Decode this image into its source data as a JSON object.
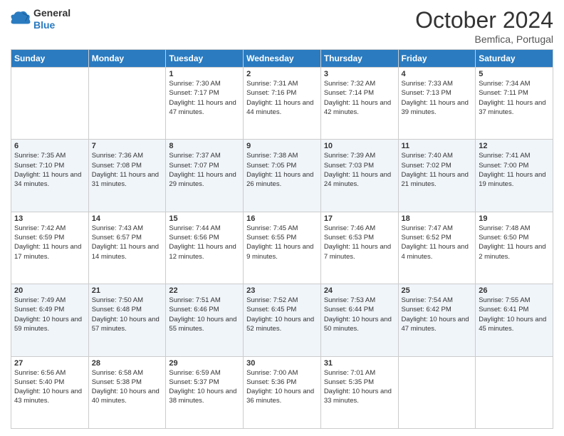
{
  "header": {
    "logo_line1": "General",
    "logo_line2": "Blue",
    "month": "October 2024",
    "location": "Bemfica, Portugal"
  },
  "weekdays": [
    "Sunday",
    "Monday",
    "Tuesday",
    "Wednesday",
    "Thursday",
    "Friday",
    "Saturday"
  ],
  "weeks": [
    [
      {
        "day": "",
        "sunrise": "",
        "sunset": "",
        "daylight": ""
      },
      {
        "day": "",
        "sunrise": "",
        "sunset": "",
        "daylight": ""
      },
      {
        "day": "1",
        "sunrise": "Sunrise: 7:30 AM",
        "sunset": "Sunset: 7:17 PM",
        "daylight": "Daylight: 11 hours and 47 minutes."
      },
      {
        "day": "2",
        "sunrise": "Sunrise: 7:31 AM",
        "sunset": "Sunset: 7:16 PM",
        "daylight": "Daylight: 11 hours and 44 minutes."
      },
      {
        "day": "3",
        "sunrise": "Sunrise: 7:32 AM",
        "sunset": "Sunset: 7:14 PM",
        "daylight": "Daylight: 11 hours and 42 minutes."
      },
      {
        "day": "4",
        "sunrise": "Sunrise: 7:33 AM",
        "sunset": "Sunset: 7:13 PM",
        "daylight": "Daylight: 11 hours and 39 minutes."
      },
      {
        "day": "5",
        "sunrise": "Sunrise: 7:34 AM",
        "sunset": "Sunset: 7:11 PM",
        "daylight": "Daylight: 11 hours and 37 minutes."
      }
    ],
    [
      {
        "day": "6",
        "sunrise": "Sunrise: 7:35 AM",
        "sunset": "Sunset: 7:10 PM",
        "daylight": "Daylight: 11 hours and 34 minutes."
      },
      {
        "day": "7",
        "sunrise": "Sunrise: 7:36 AM",
        "sunset": "Sunset: 7:08 PM",
        "daylight": "Daylight: 11 hours and 31 minutes."
      },
      {
        "day": "8",
        "sunrise": "Sunrise: 7:37 AM",
        "sunset": "Sunset: 7:07 PM",
        "daylight": "Daylight: 11 hours and 29 minutes."
      },
      {
        "day": "9",
        "sunrise": "Sunrise: 7:38 AM",
        "sunset": "Sunset: 7:05 PM",
        "daylight": "Daylight: 11 hours and 26 minutes."
      },
      {
        "day": "10",
        "sunrise": "Sunrise: 7:39 AM",
        "sunset": "Sunset: 7:03 PM",
        "daylight": "Daylight: 11 hours and 24 minutes."
      },
      {
        "day": "11",
        "sunrise": "Sunrise: 7:40 AM",
        "sunset": "Sunset: 7:02 PM",
        "daylight": "Daylight: 11 hours and 21 minutes."
      },
      {
        "day": "12",
        "sunrise": "Sunrise: 7:41 AM",
        "sunset": "Sunset: 7:00 PM",
        "daylight": "Daylight: 11 hours and 19 minutes."
      }
    ],
    [
      {
        "day": "13",
        "sunrise": "Sunrise: 7:42 AM",
        "sunset": "Sunset: 6:59 PM",
        "daylight": "Daylight: 11 hours and 17 minutes."
      },
      {
        "day": "14",
        "sunrise": "Sunrise: 7:43 AM",
        "sunset": "Sunset: 6:57 PM",
        "daylight": "Daylight: 11 hours and 14 minutes."
      },
      {
        "day": "15",
        "sunrise": "Sunrise: 7:44 AM",
        "sunset": "Sunset: 6:56 PM",
        "daylight": "Daylight: 11 hours and 12 minutes."
      },
      {
        "day": "16",
        "sunrise": "Sunrise: 7:45 AM",
        "sunset": "Sunset: 6:55 PM",
        "daylight": "Daylight: 11 hours and 9 minutes."
      },
      {
        "day": "17",
        "sunrise": "Sunrise: 7:46 AM",
        "sunset": "Sunset: 6:53 PM",
        "daylight": "Daylight: 11 hours and 7 minutes."
      },
      {
        "day": "18",
        "sunrise": "Sunrise: 7:47 AM",
        "sunset": "Sunset: 6:52 PM",
        "daylight": "Daylight: 11 hours and 4 minutes."
      },
      {
        "day": "19",
        "sunrise": "Sunrise: 7:48 AM",
        "sunset": "Sunset: 6:50 PM",
        "daylight": "Daylight: 11 hours and 2 minutes."
      }
    ],
    [
      {
        "day": "20",
        "sunrise": "Sunrise: 7:49 AM",
        "sunset": "Sunset: 6:49 PM",
        "daylight": "Daylight: 10 hours and 59 minutes."
      },
      {
        "day": "21",
        "sunrise": "Sunrise: 7:50 AM",
        "sunset": "Sunset: 6:48 PM",
        "daylight": "Daylight: 10 hours and 57 minutes."
      },
      {
        "day": "22",
        "sunrise": "Sunrise: 7:51 AM",
        "sunset": "Sunset: 6:46 PM",
        "daylight": "Daylight: 10 hours and 55 minutes."
      },
      {
        "day": "23",
        "sunrise": "Sunrise: 7:52 AM",
        "sunset": "Sunset: 6:45 PM",
        "daylight": "Daylight: 10 hours and 52 minutes."
      },
      {
        "day": "24",
        "sunrise": "Sunrise: 7:53 AM",
        "sunset": "Sunset: 6:44 PM",
        "daylight": "Daylight: 10 hours and 50 minutes."
      },
      {
        "day": "25",
        "sunrise": "Sunrise: 7:54 AM",
        "sunset": "Sunset: 6:42 PM",
        "daylight": "Daylight: 10 hours and 47 minutes."
      },
      {
        "day": "26",
        "sunrise": "Sunrise: 7:55 AM",
        "sunset": "Sunset: 6:41 PM",
        "daylight": "Daylight: 10 hours and 45 minutes."
      }
    ],
    [
      {
        "day": "27",
        "sunrise": "Sunrise: 6:56 AM",
        "sunset": "Sunset: 5:40 PM",
        "daylight": "Daylight: 10 hours and 43 minutes."
      },
      {
        "day": "28",
        "sunrise": "Sunrise: 6:58 AM",
        "sunset": "Sunset: 5:38 PM",
        "daylight": "Daylight: 10 hours and 40 minutes."
      },
      {
        "day": "29",
        "sunrise": "Sunrise: 6:59 AM",
        "sunset": "Sunset: 5:37 PM",
        "daylight": "Daylight: 10 hours and 38 minutes."
      },
      {
        "day": "30",
        "sunrise": "Sunrise: 7:00 AM",
        "sunset": "Sunset: 5:36 PM",
        "daylight": "Daylight: 10 hours and 36 minutes."
      },
      {
        "day": "31",
        "sunrise": "Sunrise: 7:01 AM",
        "sunset": "Sunset: 5:35 PM",
        "daylight": "Daylight: 10 hours and 33 minutes."
      },
      {
        "day": "",
        "sunrise": "",
        "sunset": "",
        "daylight": ""
      },
      {
        "day": "",
        "sunrise": "",
        "sunset": "",
        "daylight": ""
      }
    ]
  ]
}
